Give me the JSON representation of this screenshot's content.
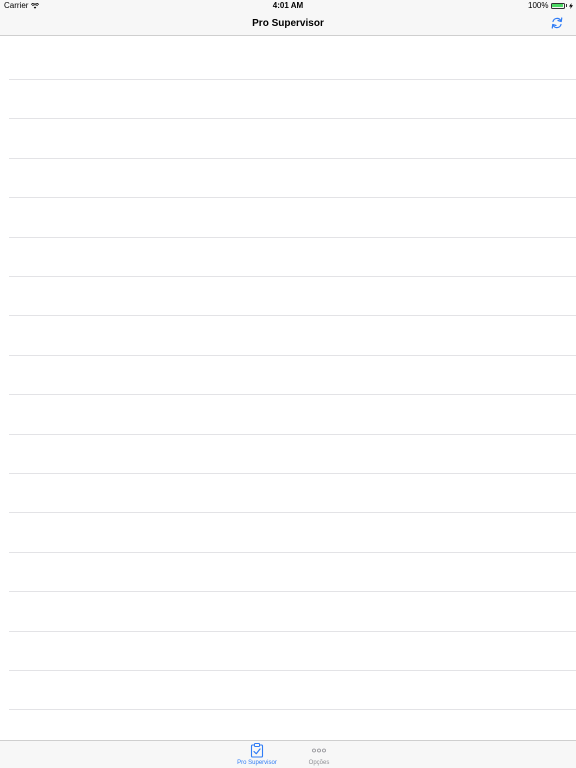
{
  "status_bar": {
    "carrier": "Carrier",
    "time": "4:01 AM",
    "battery": "100%",
    "battery_fill": 1.0
  },
  "nav_bar": {
    "title": "Pro Supervisor",
    "refresh_icon": "refresh-icon"
  },
  "list": {
    "row_count": 18
  },
  "tab_bar": {
    "tabs": [
      {
        "label": "Pro Supervisor",
        "icon": "clipboard-check-icon",
        "active": true
      },
      {
        "label": "Opções",
        "icon": "more-dots-icon",
        "active": false
      }
    ]
  },
  "colors": {
    "accent": "#2f7cf6",
    "inactive": "#8e8e93",
    "separator": "#e3e3e6",
    "bar_background": "#f7f7f7",
    "battery": "#4cd964"
  }
}
